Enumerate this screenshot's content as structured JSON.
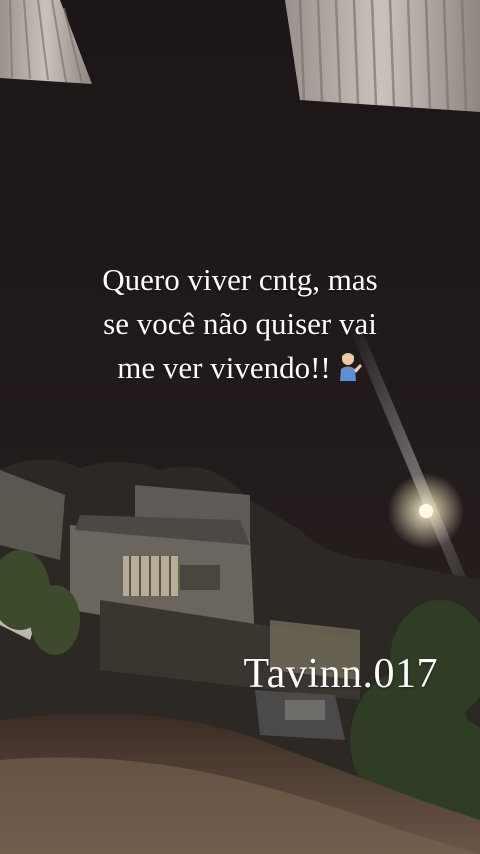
{
  "story": {
    "caption_lines": [
      "Quero viver cntg, mas",
      "se você não quiser vai",
      "me ver vivendo!!"
    ],
    "emoji": "person-tipping-hand-emoji",
    "signature": "Tavinn.017"
  },
  "colors": {
    "sky": "#1d1717",
    "text": "#ffffff",
    "lamp": "#fffbe6"
  }
}
